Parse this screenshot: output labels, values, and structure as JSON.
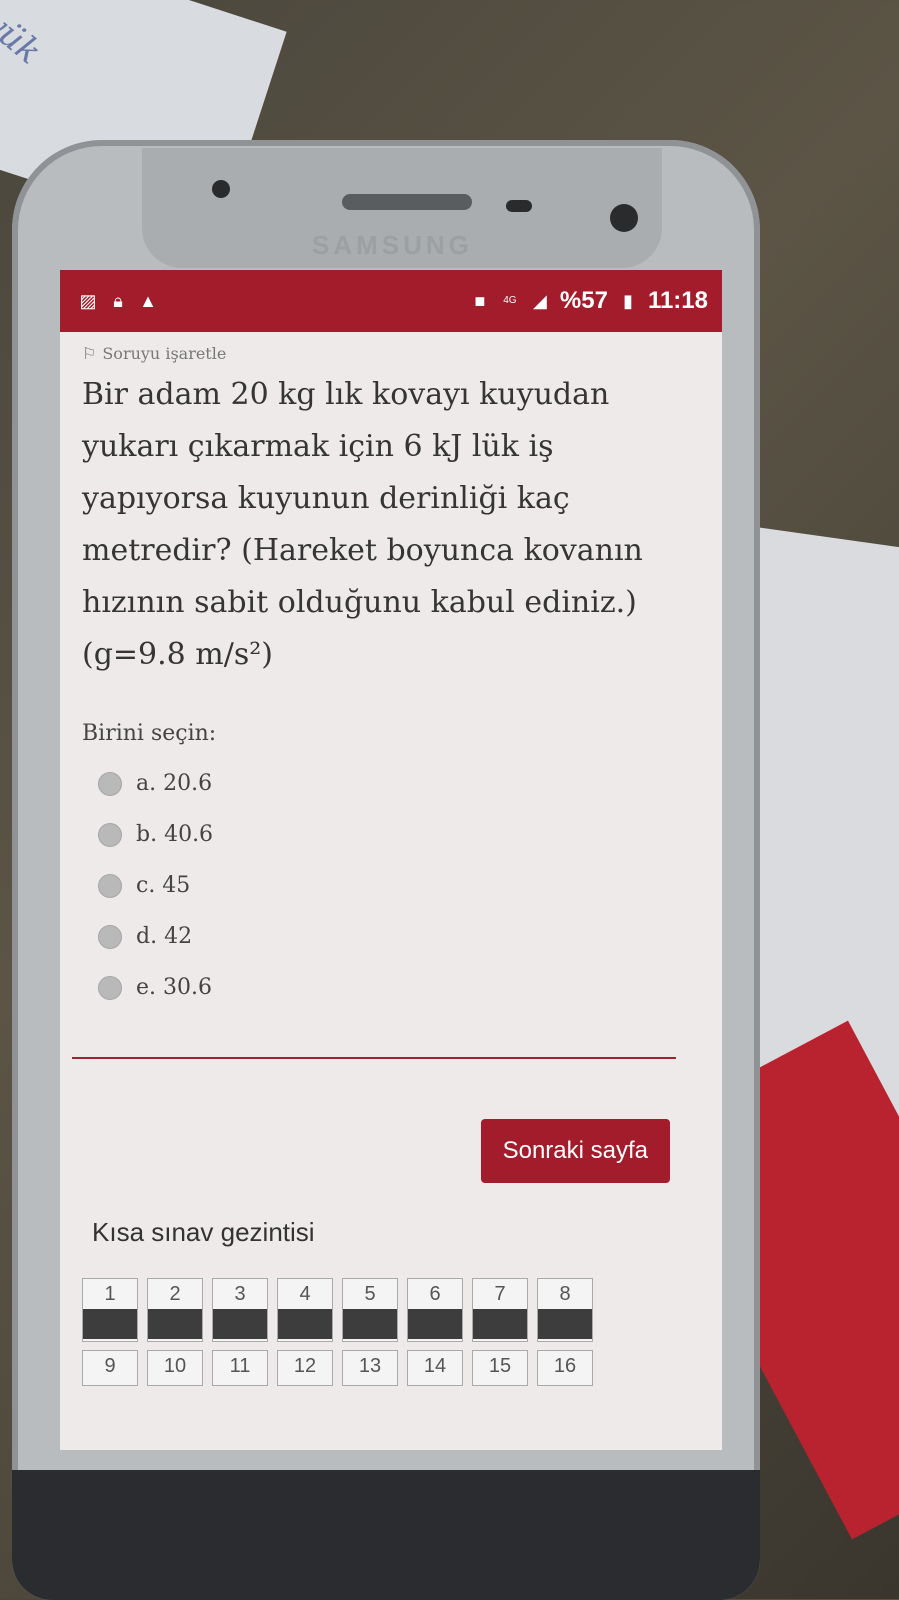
{
  "background": {
    "paper_text": "yük",
    "brand": "SAMSUNG"
  },
  "statusbar": {
    "left_icons": [
      "image-icon",
      "lock-icon",
      "warning-icon"
    ],
    "right_icons": [
      "sim-icon",
      "network-4g-icon",
      "signal-icon"
    ],
    "battery": "%57",
    "time": "11:18"
  },
  "flag": {
    "label": "Soruyu işaretle"
  },
  "question": {
    "text": "Bir adam 20 kg lık kovayı kuyudan yukarı çıkarmak için 6 kJ lük iş yapıyorsa kuyunun derinliği kaç metredir? (Hareket boyunca kovanın hızının sabit olduğunu kabul ediniz.) (g=9.8 m/s²)"
  },
  "answers": {
    "prompt": "Birini seçin:",
    "options": [
      {
        "label": "a. 20.6"
      },
      {
        "label": "b. 40.6"
      },
      {
        "label": "c. 45"
      },
      {
        "label": "d. 42"
      },
      {
        "label": "e. 30.6"
      }
    ]
  },
  "actions": {
    "next_label": "Sonraki sayfa"
  },
  "navigation": {
    "title": "Kısa sınav gezintisi",
    "pages": [
      "1",
      "2",
      "3",
      "4",
      "5",
      "6",
      "7",
      "8",
      "9",
      "10",
      "11",
      "12",
      "13",
      "14",
      "15",
      "16"
    ]
  },
  "colors": {
    "accent": "#a31c2b",
    "screen_bg": "#eeeaea"
  }
}
